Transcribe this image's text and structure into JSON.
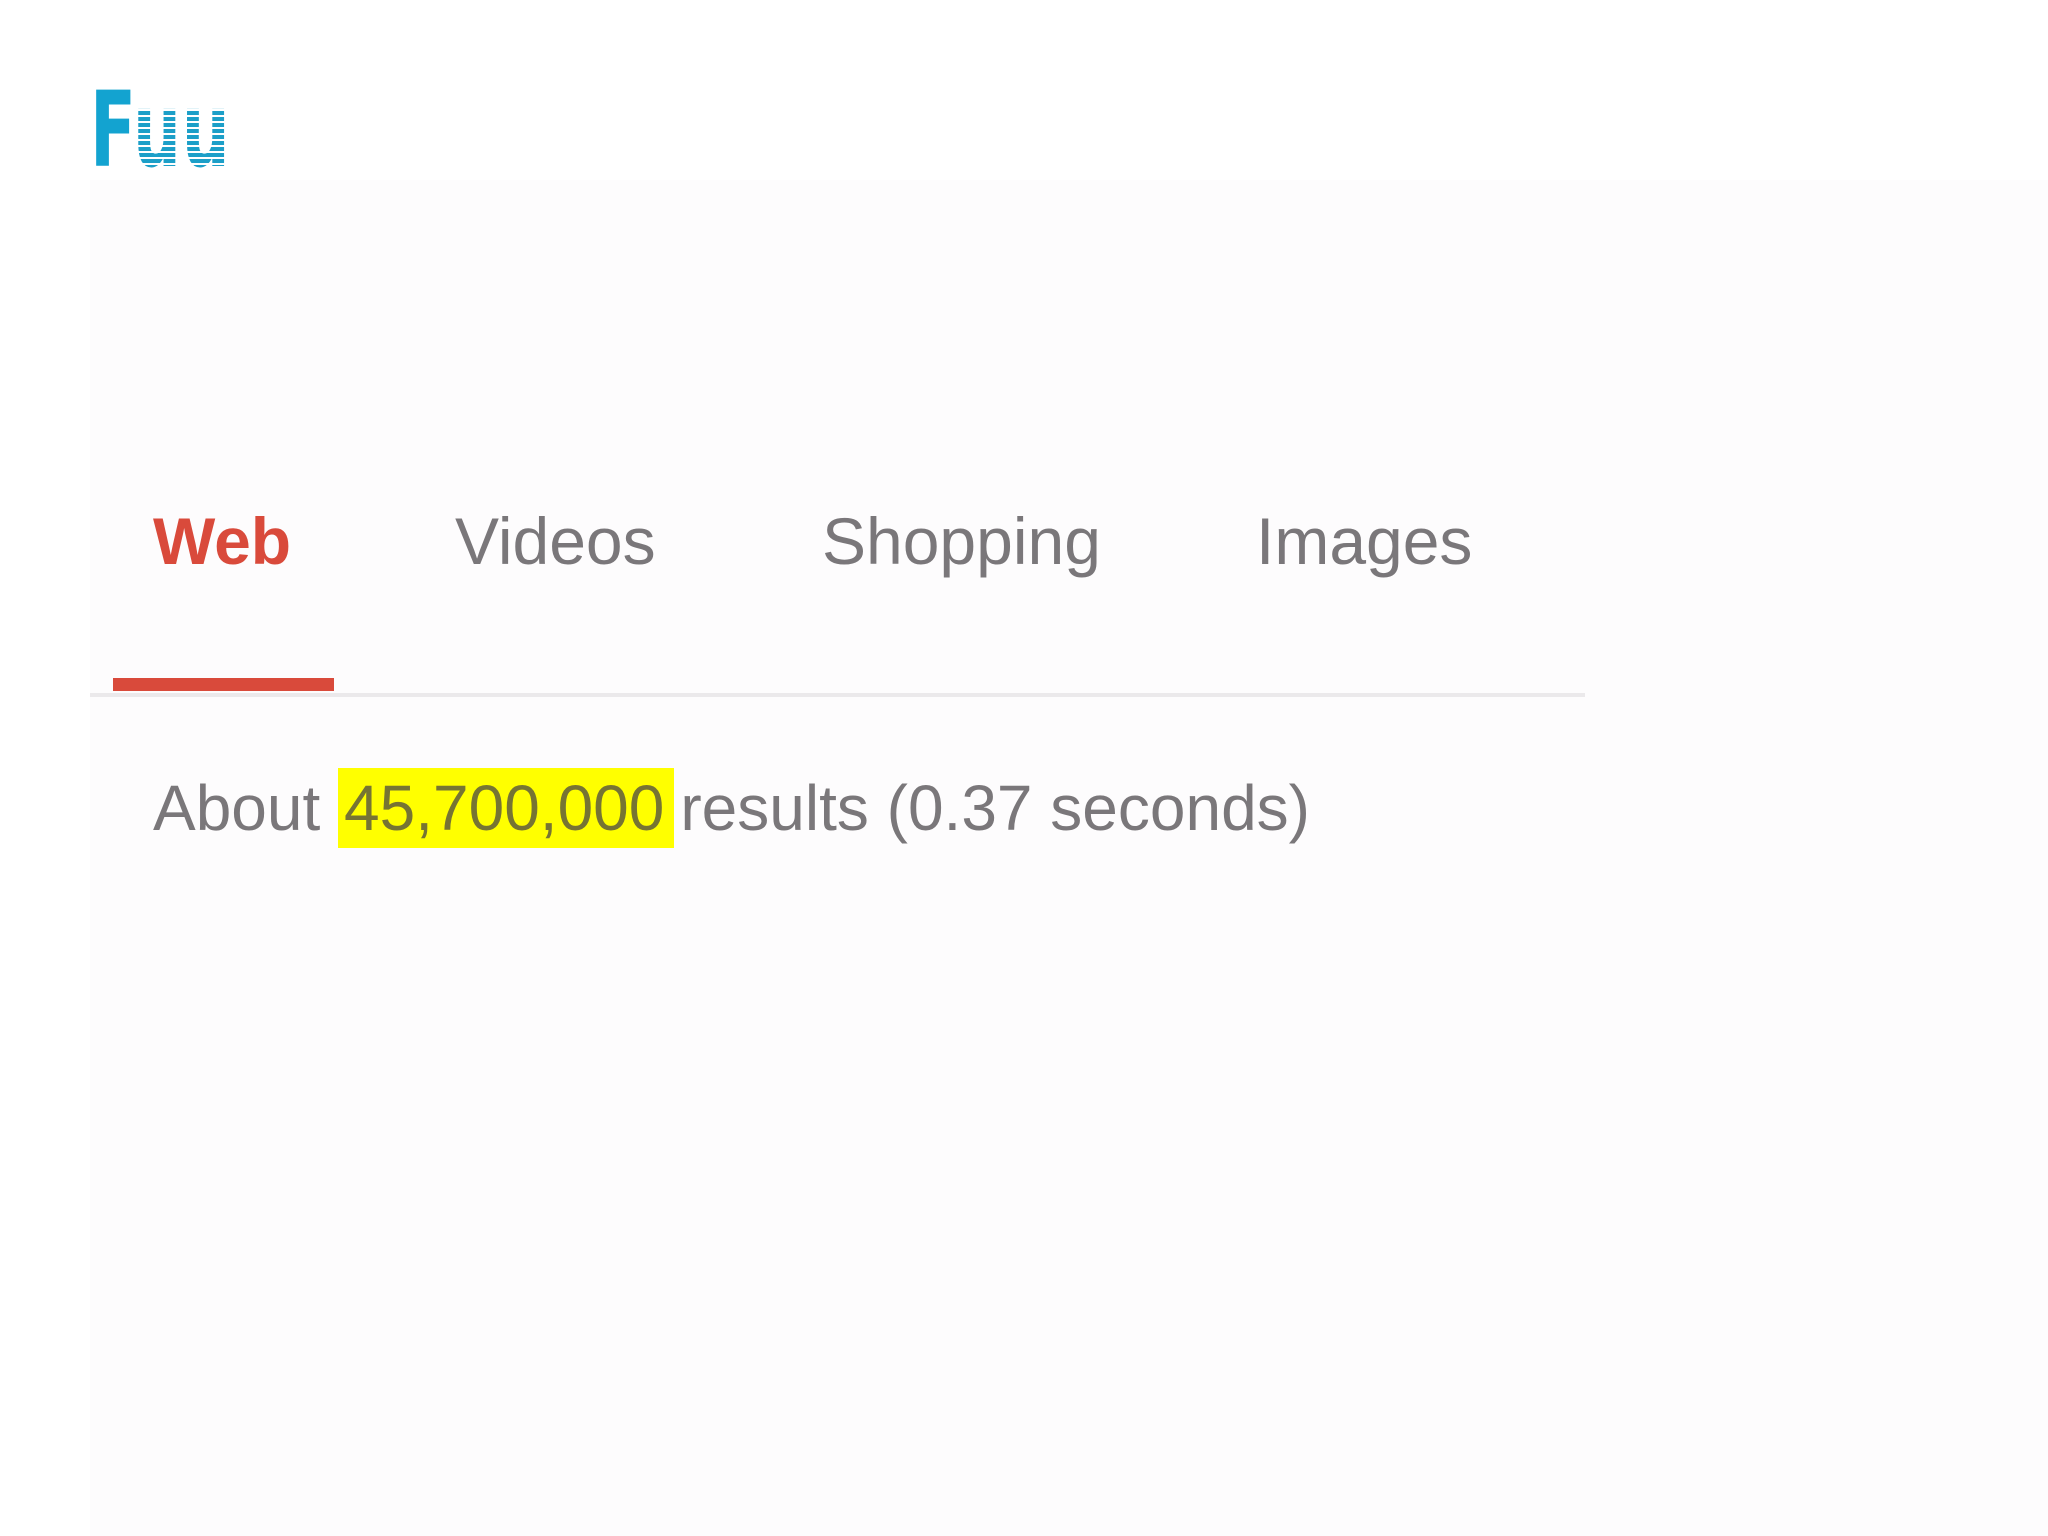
{
  "logo": {
    "text_f": "F",
    "text_uu": "uu"
  },
  "colors": {
    "accent_active_tab": "#d94a3b",
    "tab_inactive": "#7a777a",
    "logo": "#1aa3cc",
    "highlight": "#ffff00"
  },
  "tabs": [
    {
      "label": "Web",
      "active": true
    },
    {
      "label": "Videos",
      "active": false
    },
    {
      "label": "Shopping",
      "active": false
    },
    {
      "label": "Images",
      "active": false
    }
  ],
  "results": {
    "prefix": "About",
    "count": "45,700,000",
    "suffix": "results (0.37 seconds)"
  }
}
